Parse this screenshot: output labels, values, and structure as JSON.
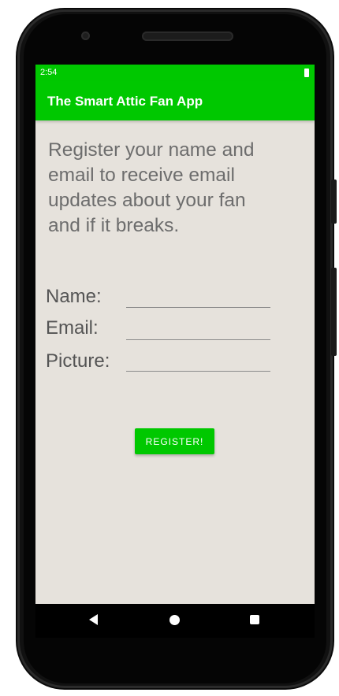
{
  "status_bar": {
    "time": "2:54"
  },
  "app_bar": {
    "title": "The Smart Attic Fan App"
  },
  "main": {
    "intro_lines": [
      "Register your name and",
      "email to receive email",
      "updates about your fan",
      "and if it breaks."
    ],
    "form": {
      "fields": [
        {
          "label": "Name:",
          "value": ""
        },
        {
          "label": "Email:",
          "value": ""
        },
        {
          "label": "Picture:",
          "value": ""
        }
      ]
    },
    "register_button_label": "REGISTER!"
  },
  "colors": {
    "accent": "#00c800",
    "screen_background": "#e6e2dc",
    "intro_text": "#6d6d6d",
    "label_text": "#545454"
  },
  "icons": {
    "battery": "battery-icon",
    "back": "nav-back-icon",
    "home": "nav-home-icon",
    "recents": "nav-recents-icon"
  }
}
